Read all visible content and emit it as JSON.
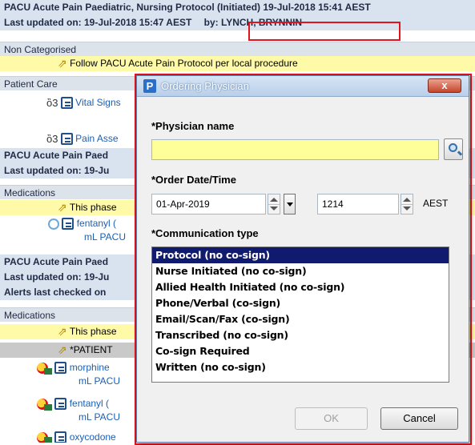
{
  "background": {
    "header1": "PACU Acute Pain Paediatric, Nursing Protocol (Initiated) 19-Jul-2018 15:41 AEST",
    "updated1": "Last updated on: 19-Jul-2018 15:47 AEST",
    "updated1_by": "by: LYNCH, BRYNNIN",
    "cat_non": "Non Categorised",
    "follow": "Follow PACU Acute Pain Protocol per local procedure",
    "cat_patient_care": "Patient Care",
    "vital_signs": "Vital Signs",
    "pain_asse": "Pain Asse",
    "header2": "PACU Acute Pain Paed",
    "updated2": "Last updated on: 19-Ju",
    "cat_meds1": "Medications",
    "this_phase1": "This phase",
    "fentanyl1": "fentanyl (",
    "ml_pacu1": "mL PACU",
    "header3": "PACU Acute Pain Paed",
    "updated3": "Last updated on: 19-Ju",
    "alerts": "Alerts last checked on",
    "cat_meds2": "Medications",
    "this_phase2": "This phase",
    "patient": "*PATIENT",
    "morphine": "morphine",
    "ml_pacu2": "mL PACU",
    "fentanyl2": "fentanyl (",
    "ml_pacu3": "mL PACU",
    "oxycodone": "oxycodone"
  },
  "dialog": {
    "title": "Ordering Physician",
    "close_label": "x",
    "app_icon_letter": "P",
    "physician_label": "*Physician name",
    "physician_value": "",
    "order_label": "*Order Date/Time",
    "date_value": "01-Apr-2019",
    "time_value": "1214",
    "timezone": "AEST",
    "comm_label": "*Communication type",
    "comm_options": [
      "Protocol (no co-sign)",
      "Nurse Initiated (no co-sign)",
      "Allied Health Initiated (no co-sign)",
      "Phone/Verbal (co-sign)",
      "Email/Scan/Fax (co-sign)",
      "Transcribed (no co-sign)",
      "Co-sign Required",
      "Written (no co-sign)"
    ],
    "comm_selected": "Protocol (no co-sign)",
    "ok_label": "OK",
    "cancel_label": "Cancel"
  },
  "colors": {
    "highlight_outline": "#e0141c",
    "selected_item": "#101a6e",
    "required_field": "#ffff99",
    "yellow_row": "#fffaa8"
  }
}
